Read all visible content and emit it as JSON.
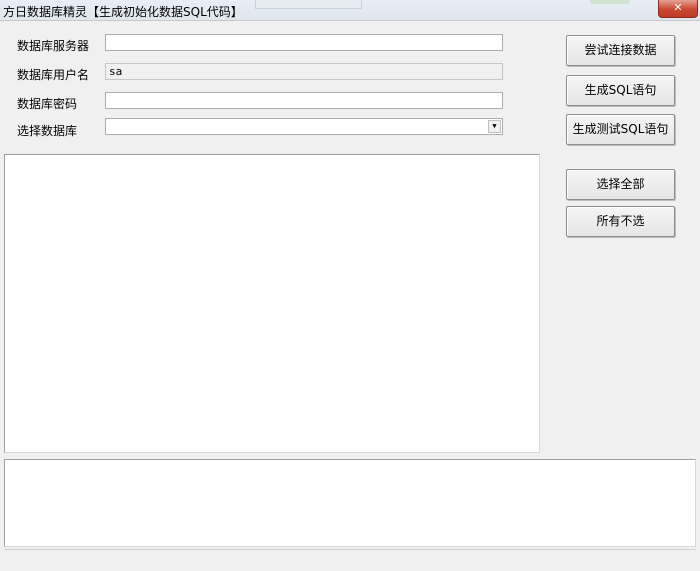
{
  "window": {
    "title": "方日数据库精灵【生成初始化数据SQL代码】",
    "close_glyph": "✕"
  },
  "form": {
    "server_label": "数据库服务器",
    "server_value": "",
    "user_label": "数据库用户名",
    "user_value": "sa",
    "password_label": "数据库密码",
    "password_value": "",
    "database_label": "选择数据库",
    "database_value": "",
    "combo_arrow_glyph": "▼"
  },
  "buttons": {
    "test_connection": "尝试连接数据",
    "generate_sql": "生成SQL语句",
    "generate_test_sql": "生成测试SQL语句",
    "select_all": "选择全部",
    "select_none": "所有不选"
  },
  "table_list": {
    "items": []
  },
  "output": {
    "text": ""
  }
}
